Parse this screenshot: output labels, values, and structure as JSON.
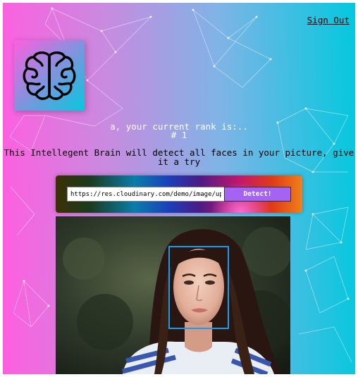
{
  "nav": {
    "sign_out_label": "Sign Out"
  },
  "logo": {
    "icon": "brain-icon"
  },
  "rank": {
    "line1": "a, your current rank is:..",
    "line2": "# 1"
  },
  "description": "This Intellegent Brain will detect all faces in your picture, give it a try",
  "form": {
    "url_value": "https://res.cloudinary.com/demo/image/upload/woman.jpg",
    "detect_label": "Detect!"
  },
  "detection": {
    "face_box_color": "#149df2"
  },
  "colors": {
    "gradient_left": "#ff5edf",
    "gradient_right": "#04c8de",
    "button": "#a463f2"
  }
}
